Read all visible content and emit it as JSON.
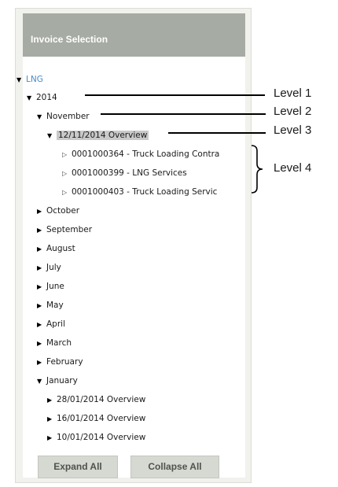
{
  "panel": {
    "title": "Invoice Selection",
    "tree": [
      {
        "label": "LNG",
        "state": "expanded"
      },
      {
        "label": "2014",
        "state": "expanded"
      },
      {
        "label": "November",
        "state": "expanded"
      },
      {
        "label": "12/11/2014 Overview",
        "state": "expanded",
        "selected": true
      },
      {
        "label": "0001000364 - Truck Loading Contra",
        "state": "leaf"
      },
      {
        "label": "0001000399 - LNG Services",
        "state": "leaf"
      },
      {
        "label": "0001000403 - Truck Loading Servic",
        "state": "leaf"
      },
      {
        "label": "October",
        "state": "collapsed"
      },
      {
        "label": "September",
        "state": "collapsed"
      },
      {
        "label": "August",
        "state": "collapsed"
      },
      {
        "label": "July",
        "state": "collapsed"
      },
      {
        "label": "June",
        "state": "collapsed"
      },
      {
        "label": "May",
        "state": "collapsed"
      },
      {
        "label": "April",
        "state": "collapsed"
      },
      {
        "label": "March",
        "state": "collapsed"
      },
      {
        "label": "February",
        "state": "collapsed"
      },
      {
        "label": "January",
        "state": "expanded"
      },
      {
        "label": "28/01/2014 Overview",
        "state": "collapsed"
      },
      {
        "label": "16/01/2014 Overview",
        "state": "collapsed"
      },
      {
        "label": "10/01/2014 Overview",
        "state": "collapsed"
      }
    ],
    "buttons": {
      "expand_all": "Expand All",
      "collapse_all": "Collapse All"
    }
  },
  "annotations": {
    "level1": "Level 1",
    "level2": "Level 2",
    "level3": "Level 3",
    "level4": "Level 4"
  },
  "colors": {
    "header_bg": "#a6aba3",
    "link_blue": "#4a8ac8",
    "button_bg": "#d6d8d2"
  }
}
